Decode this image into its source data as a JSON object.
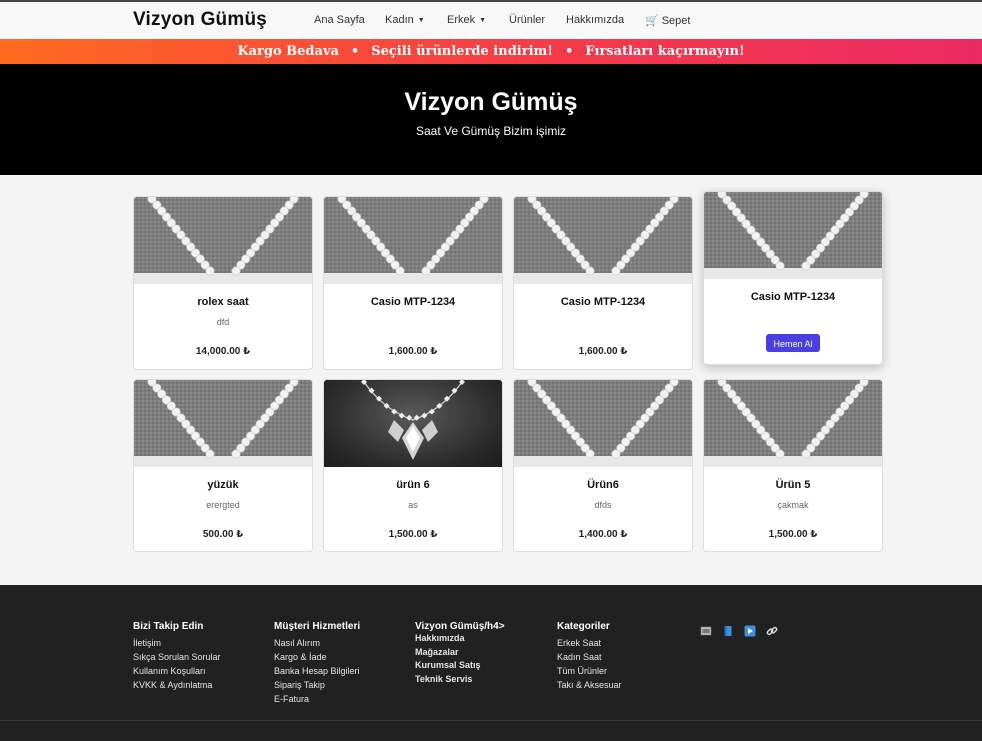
{
  "navbar": {
    "brand": "Vizyon Gümüş",
    "links": [
      {
        "label": "Ana Sayfa"
      },
      {
        "label": "Kadın"
      },
      {
        "label": "Erkek"
      },
      {
        "label": "Ürünler"
      },
      {
        "label": "Hakkımızda"
      },
      {
        "label": "Sepet",
        "icon": "cart-icon"
      }
    ]
  },
  "promo": {
    "items": [
      "Kargo Bedava",
      "Seçili ürünlerde indirim!",
      "Fırsatları kaçırmayın!"
    ],
    "separator": "•",
    "colors": [
      "#ff6a1f",
      "#ec2a63"
    ]
  },
  "hero": {
    "title": "Vizyon Gümüş",
    "subtitle": "Saat Ve Gümüş Bizim işimiz"
  },
  "products": [
    {
      "title": "rolex saat",
      "desc": "dfd",
      "price": "14,000.00 ₺",
      "image": "pearl-necklace"
    },
    {
      "title": "Casio MTP-1234",
      "desc": "",
      "price": "1,600.00 ₺",
      "image": "pearl-necklace"
    },
    {
      "title": "Casio MTP-1234",
      "desc": "",
      "price": "1,600.00 ₺",
      "image": "pearl-necklace"
    },
    {
      "title": "Casio MTP-1234",
      "desc": "",
      "price": "",
      "image": "pearl-necklace",
      "button": "Hemen Al"
    },
    {
      "title": "yüzük",
      "desc": "erergted",
      "price": "500.00 ₺",
      "image": "pearl-necklace"
    },
    {
      "title": "ürün 6",
      "desc": "as",
      "price": "1,500.00 ₺",
      "image": "diamond-necklace"
    },
    {
      "title": "Ürün6",
      "desc": "dfds",
      "price": "1,400.00 ₺",
      "image": "pearl-necklace"
    },
    {
      "title": "Ürün 5",
      "desc": "çakmak",
      "price": "1,500.00 ₺",
      "image": "pearl-necklace"
    }
  ],
  "footer": {
    "columns": [
      {
        "heading": "Bizi Takip Edin",
        "links": [
          "İletişim",
          "Sıkça Sorulan Sorular",
          "Kullanım Koşulları",
          "KVKK & Aydınlatma"
        ]
      },
      {
        "heading": "Müşteri Hizmetleri",
        "links": [
          "Nasıl Alırım",
          "Kargo & İade",
          "Banka Hesap Bilgileri",
          "Sipariş Takip",
          "E-Fatura"
        ]
      },
      {
        "heading": "Vizyon Gümüş/h4>",
        "links": [
          "Hakkımızda",
          "Mağazalar",
          "Kurumsal Satış",
          "Teknik Servis"
        ]
      },
      {
        "heading": "Kategoriler",
        "links": [
          "Erkek Saat",
          "Kadın Saat",
          "Tüm Ürünler",
          "Takı & Aksesuar"
        ]
      }
    ],
    "social_icons": [
      "image-icon",
      "bookmark-icon",
      "play-icon",
      "link-icon"
    ]
  }
}
